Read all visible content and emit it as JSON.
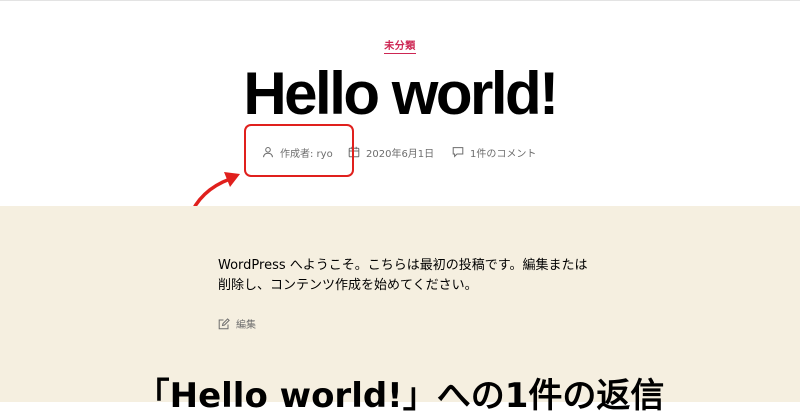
{
  "post": {
    "category": "未分類",
    "title": "Hello world!",
    "meta": {
      "author": "作成者: ryo",
      "date": "2020年6月1日",
      "comments": "1件のコメント"
    },
    "body": "WordPress へようこそ。こちらは最初の投稿です。編集または削除し、コンテンツ作成を始めてください。",
    "edit_label": "編集"
  },
  "comments_section": {
    "heading": "「Hello world!」への1件の返信"
  },
  "colors": {
    "accent": "#cd2653",
    "content_background": "#f5efe0",
    "annotation_red": "#e0201d",
    "meta_text": "#6d6d6d"
  },
  "icons": [
    "user-icon",
    "calendar-icon",
    "comment-icon",
    "edit-icon"
  ]
}
